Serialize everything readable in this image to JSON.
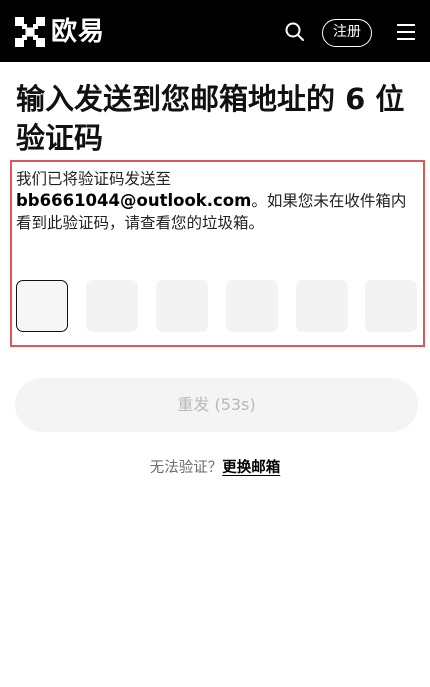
{
  "header": {
    "brand_text": "欧易",
    "register_label": "注册",
    "colors": {
      "background": "#000000",
      "foreground": "#ffffff"
    },
    "icons": [
      "okx-logo-icon",
      "search-icon",
      "menu-icon"
    ]
  },
  "page": {
    "title": "输入发送到您邮箱地址的 6 位验证码",
    "desc_prefix": "我们已将验证码发送至 ",
    "email": "bb6661044@outlook.com",
    "desc_suffix": "。如果您未在收件箱内看到此验证码，请查看您的垃圾箱。",
    "highlight_color": "#e0555a"
  },
  "code_inputs": {
    "count": 6,
    "values": [
      "",
      "",
      "",
      "",
      "",
      ""
    ]
  },
  "resend": {
    "label": "重发 (53s)",
    "disabled": true
  },
  "footer": {
    "prompt": "无法验证？",
    "change_email_label": "更换邮箱"
  }
}
